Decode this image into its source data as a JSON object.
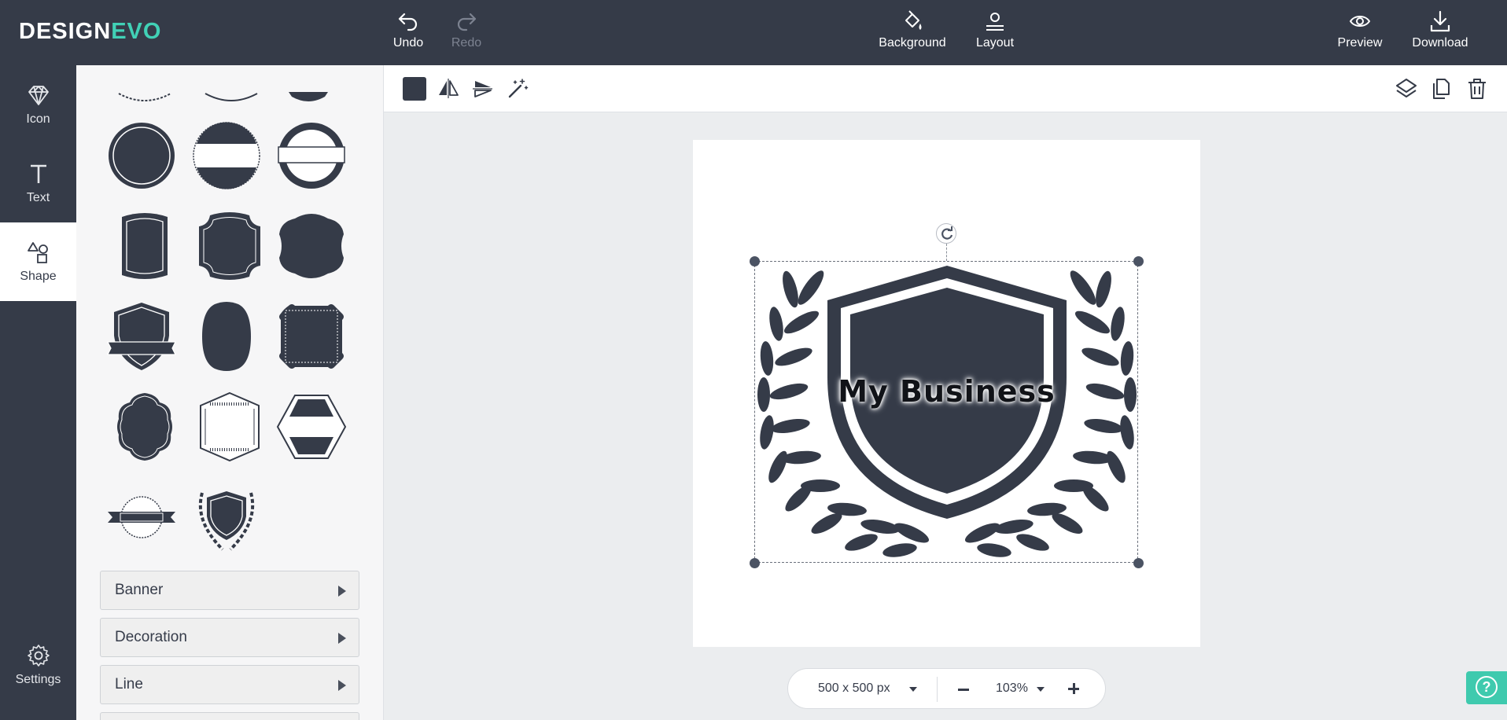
{
  "app": {
    "logo_part1": "DESIGN",
    "logo_part2": "EVO"
  },
  "topbar": {
    "undo": "Undo",
    "redo": "Redo",
    "background": "Background",
    "layout": "Layout",
    "preview": "Preview",
    "download": "Download"
  },
  "rail": {
    "icon": "Icon",
    "text": "Text",
    "shape": "Shape",
    "settings": "Settings"
  },
  "panel": {
    "categories": [
      "Banner",
      "Decoration",
      "Line"
    ]
  },
  "toolbar": {
    "fill_color": "#353b48"
  },
  "canvas": {
    "text": "My Business"
  },
  "bottom": {
    "size": "500 x 500 px",
    "zoom": "103%"
  },
  "help": {
    "label": "?"
  },
  "colors": {
    "topbar": "#353b48",
    "accent": "#41d1b6",
    "help": "#3fcaae"
  }
}
